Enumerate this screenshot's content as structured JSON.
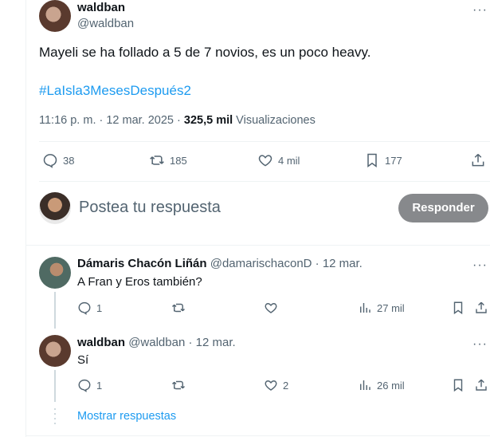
{
  "main_tweet": {
    "display_name": "waldban",
    "handle": "@waldban",
    "text": "Mayeli se ha follado a 5 de 7 novios, es un poco heavy.",
    "hashtag": "#LaIsla3MesesDespués2",
    "time": "11:16 p. m. · 12 mar. 2025 · ",
    "views_count": "325,5 mil",
    "views_label": " Visualizaciones",
    "replies": "38",
    "retweets": "185",
    "likes": "4 mil",
    "bookmarks": "177"
  },
  "reply_box": {
    "placeholder": "Postea tu respuesta",
    "button_label": "Responder"
  },
  "replies": [
    {
      "display_name": "Dámaris Chacón Liñán",
      "handle": "@damarischaconD",
      "date": " · 12 mar.",
      "text": "A Fran y Eros también?",
      "replies": "1",
      "retweets": "",
      "likes": "",
      "views": "27 mil"
    },
    {
      "display_name": "waldban",
      "handle": "@waldban",
      "date": " · 12 mar.",
      "text": "Sí",
      "replies": "1",
      "retweets": "",
      "likes": "2",
      "views": "26 mil"
    }
  ],
  "show_more": "Mostrar respuestas",
  "colors": {
    "link": "#1d9bf0",
    "muted": "#536471",
    "button_bg": "#87898c",
    "border": "#eff3f4"
  }
}
